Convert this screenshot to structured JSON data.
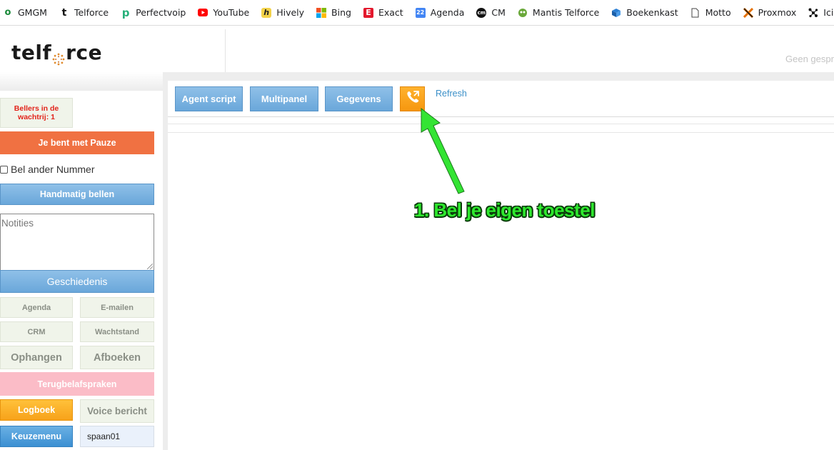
{
  "bookmarks": [
    {
      "label": "GMGM",
      "icon": "o-icon"
    },
    {
      "label": "Telforce",
      "icon": "telforce-t-icon"
    },
    {
      "label": "Perfectvoip",
      "icon": "perfectvoip-p-icon"
    },
    {
      "label": "YouTube",
      "icon": "youtube-icon"
    },
    {
      "label": "Hively",
      "icon": "hively-icon"
    },
    {
      "label": "Bing",
      "icon": "microsoft-icon"
    },
    {
      "label": "Exact",
      "icon": "exact-icon"
    },
    {
      "label": "Agenda",
      "icon": "calendar-icon"
    },
    {
      "label": "CM",
      "icon": "cm-icon"
    },
    {
      "label": "Mantis Telforce",
      "icon": "mantis-icon"
    },
    {
      "label": "Boekenkast",
      "icon": "book-icon"
    },
    {
      "label": "Motto",
      "icon": "page-icon"
    },
    {
      "label": "Proxmox",
      "icon": "proxmox-icon"
    },
    {
      "label": "Icinga",
      "icon": "icinga-icon"
    }
  ],
  "header": {
    "logo_left": "telf",
    "logo_right": "rce",
    "status_text": "Geen gesprek"
  },
  "sidebar": {
    "wachtrij": "Bellers in de wachtrij: 1",
    "pauze": "Je bent met Pauze",
    "bel_ander": "Bel ander Nummer",
    "handmatig": "Handmatig bellen",
    "notities_placeholder": "Notities",
    "geschiedenis": "Geschiedenis",
    "agenda": "Agenda",
    "email": "E-mailen",
    "crm": "CRM",
    "wachtstand": "Wachtstand",
    "ophangen": "Ophangen",
    "afboeken": "Afboeken",
    "terugbel": "Terugbelafspraken",
    "logboek": "Logboek",
    "voice": "Voice bericht",
    "keuzemenu": "Keuzemenu",
    "user": "spaan01"
  },
  "main": {
    "tabs": [
      "Agent script",
      "Multipanel",
      "Gegevens"
    ],
    "refresh": "Refresh"
  },
  "annotation": {
    "text": "1. Bel je eigen toestel",
    "color": "#2ee82e"
  },
  "colors": {
    "pauze": "#f07142",
    "tab_blue": "#7bb3e0",
    "phone_orange": "#f8a11d",
    "terugbel_pink": "#fbbcc7"
  }
}
